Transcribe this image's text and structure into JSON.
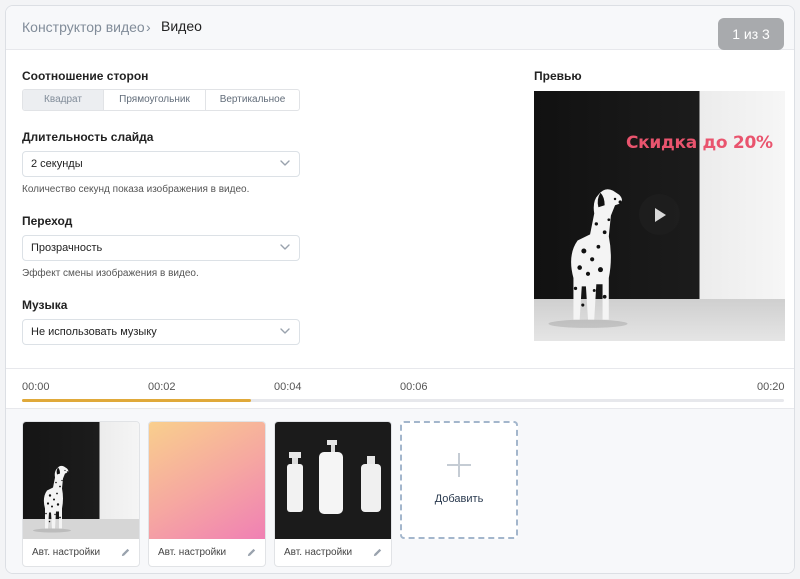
{
  "header": {
    "breadcrumb_parent": "Конструктор видео",
    "breadcrumb_separator": "›",
    "breadcrumb_current": "Видео",
    "step_indicator": "1 из 3"
  },
  "form": {
    "aspect": {
      "label": "Соотношение сторон",
      "options": [
        "Квадрат",
        "Прямоугольник",
        "Вертикальное"
      ],
      "selected": "Квадрат"
    },
    "duration": {
      "label": "Длительность слайда",
      "value": "2 секунды",
      "hint": "Количество секунд показа изображения в видео."
    },
    "transition": {
      "label": "Переход",
      "value": "Прозрачность",
      "hint": "Эффект смены изображения в видео."
    },
    "music": {
      "label": "Музыка",
      "value": "Не использовать музыку"
    }
  },
  "preview": {
    "label": "Превью",
    "promo_text": "Скидка до 20%"
  },
  "timeline": {
    "labels": [
      "00:00",
      "00:02",
      "00:04",
      "00:06",
      "00:20"
    ],
    "progress_fraction": 0.3,
    "progress_color": "#e0a93a"
  },
  "slides": [
    {
      "caption": "Авт. настройки",
      "image": "dalmatian"
    },
    {
      "caption": "Авт. настройки",
      "image": "gradient"
    },
    {
      "caption": "Авт. настройки",
      "image": "bottles"
    }
  ],
  "add_slide": {
    "label": "Добавить"
  },
  "colors": {
    "accent_dark": "#222222",
    "muted": "#818c99",
    "promo": "#e9546e",
    "dashed_border": "#a3b6cc"
  }
}
